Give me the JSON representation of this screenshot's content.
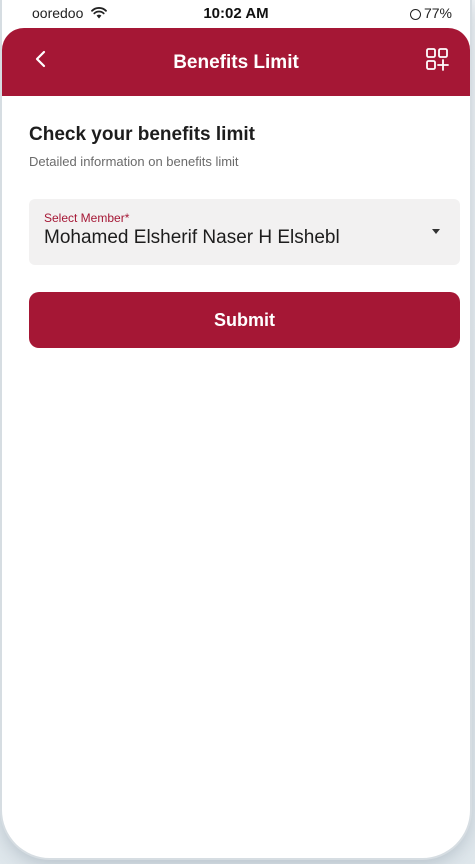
{
  "status_bar": {
    "carrier": "ooredoo",
    "time": "10:02 AM",
    "battery": "77%"
  },
  "app_bar": {
    "title": "Benefits Limit",
    "back_icon": "chevron-left-icon",
    "menu_icon": "grid-add-icon"
  },
  "page": {
    "heading": "Check your benefits limit",
    "subheading": "Detailed information on benefits limit"
  },
  "member_select": {
    "label": "Select Member*",
    "value": "Mohamed Elsherif Naser H Elshebl"
  },
  "actions": {
    "submit_label": "Submit"
  },
  "colors": {
    "brand": "#a51735",
    "field_bg": "#f2f1f1",
    "text_primary": "#1d1d1d",
    "text_secondary": "#6b6b6b"
  }
}
